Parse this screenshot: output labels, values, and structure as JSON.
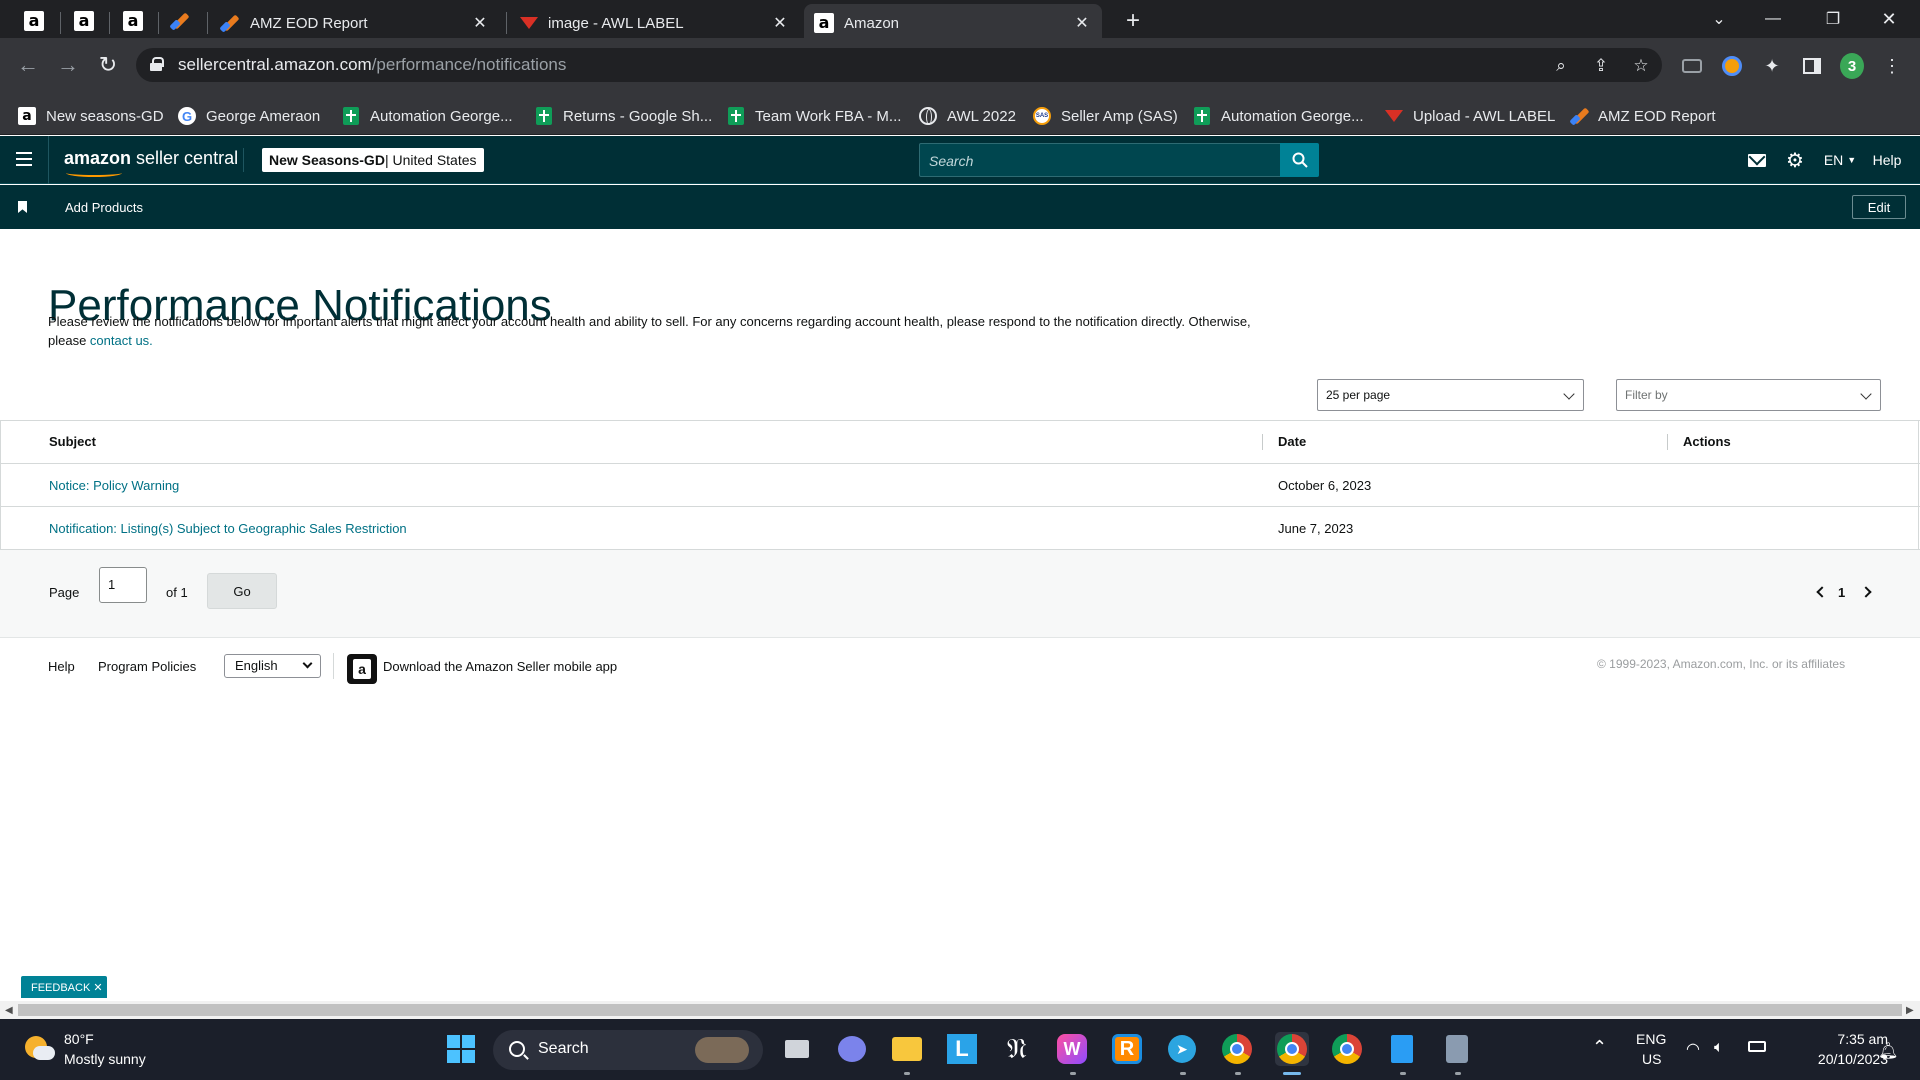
{
  "browser": {
    "tabs": [
      {
        "title": "AMZ EOD Report"
      },
      {
        "title": "image - AWL LABEL"
      },
      {
        "title": "Amazon"
      }
    ],
    "url_host": "sellercentral.amazon.com",
    "url_path": "/performance/notifications",
    "bookmarks": [
      "New seasons-GD",
      "George Ameraon",
      "Automation George...",
      "Returns - Google Sh...",
      "Team Work FBA - M...",
      "AWL 2022",
      "Seller Amp (SAS)",
      "Automation George...",
      "Upload - AWL LABEL",
      "AMZ EOD Report"
    ]
  },
  "header": {
    "logo_bold": "amazon",
    "logo_rest": " seller central",
    "account_name": "New Seasons-GD",
    "account_region": " | United States",
    "search_placeholder": "Search",
    "language": "EN",
    "help": "Help"
  },
  "nav": {
    "add_products": "Add Products",
    "edit": "Edit"
  },
  "page": {
    "title": "Performance Notifications",
    "description": "Please review the notifications below for important alerts that might affect your account health and ability to sell. For any concerns regarding account health, please respond to the notification directly. Otherwise, please ",
    "contact_link": "contact us.",
    "per_page": "25 per page",
    "filter_by": "Filter by"
  },
  "table": {
    "headers": {
      "subject": "Subject",
      "date": "Date",
      "actions": "Actions"
    },
    "rows": [
      {
        "subject": "Notice: Policy Warning",
        "date": "October 6, 2023"
      },
      {
        "subject": "Notification: Listing(s) Subject to Geographic Sales Restriction",
        "date": "June 7, 2023"
      }
    ]
  },
  "pager": {
    "page_label": "Page",
    "page_value": "1",
    "of_label": "of 1",
    "go": "Go",
    "current": "1"
  },
  "footer": {
    "help": "Help",
    "program_policies": "Program Policies",
    "language": "English",
    "download_app": "Download the Amazon Seller mobile app",
    "copyright": "© 1999-2023, Amazon.com, Inc. or its affiliates"
  },
  "feedback": "FEEDBACK ✕",
  "taskbar": {
    "temperature": "80°F",
    "weather": "Mostly sunny",
    "search": "Search",
    "lang_top": "ENG",
    "lang_bottom": "US",
    "time": "7:35 am",
    "date": "20/10/2023"
  },
  "colors": {
    "header_bg": "#002f36",
    "search_btn": "#008296",
    "link": "#007185",
    "title": "#002f36"
  }
}
